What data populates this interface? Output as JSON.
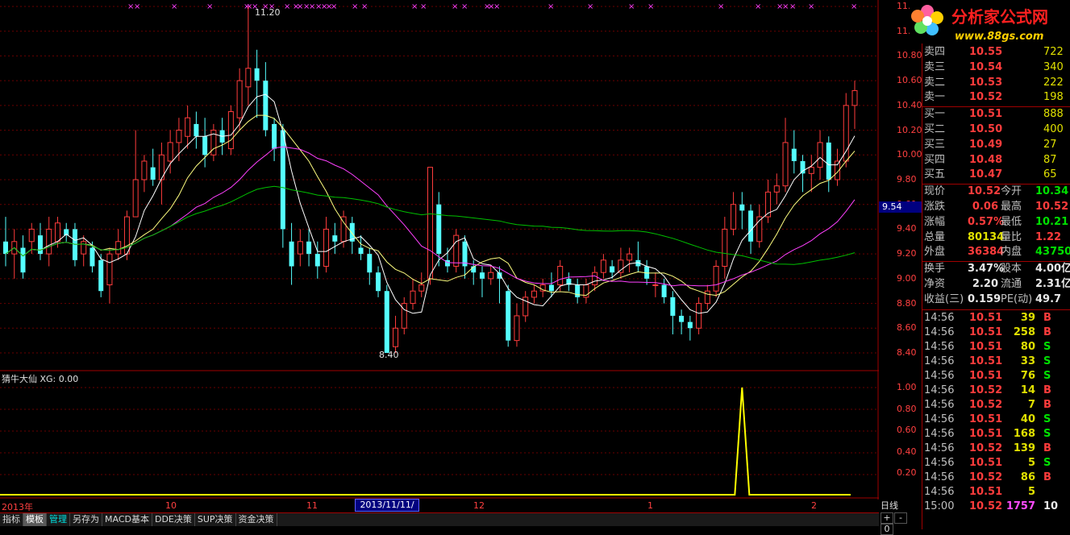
{
  "app": {
    "title_partial": "分析家公式网",
    "logo_url_text": "www.88gs.com"
  },
  "price_axis": {
    "ticks": [
      "11.20",
      "11.00",
      "10.80",
      "10.60",
      "10.40",
      "10.20",
      "10.00",
      "9.80",
      "9.60",
      "9.40",
      "9.20",
      "9.00",
      "8.80",
      "8.60",
      "8.40"
    ],
    "current_tag": "9.54"
  },
  "annotations": {
    "high_label": "11.20",
    "low_label": "8.40"
  },
  "indicator": {
    "title": "猜牛大仙 XG: 0.00",
    "ticks": [
      "1.00",
      "0.80",
      "0.60",
      "0.40",
      "0.20"
    ],
    "signal_color": "#ffff00"
  },
  "date_axis": {
    "labels": [
      {
        "text": "2013年"
      },
      {
        "text": "10"
      },
      {
        "text": "11"
      },
      {
        "text": "12"
      },
      {
        "text": "1"
      },
      {
        "text": "2"
      }
    ],
    "highlight": "2013/11/11/一",
    "period": "日线"
  },
  "zoom_buttons": [
    "+",
    "-",
    "0"
  ],
  "bottom_tabs": [
    {
      "label": "指标"
    },
    {
      "label": "模板",
      "active": true
    },
    {
      "label": "管理"
    },
    {
      "label": "另存为"
    },
    {
      "label": "MACD基本"
    },
    {
      "label": "DDE决策"
    },
    {
      "label": "SUP决策"
    },
    {
      "label": "资金决策"
    }
  ],
  "order_book": {
    "sell": [
      {
        "label": "卖四",
        "price": "10.55",
        "vol": "722"
      },
      {
        "label": "卖三",
        "price": "10.54",
        "vol": "340"
      },
      {
        "label": "卖二",
        "price": "10.53",
        "vol": "222"
      },
      {
        "label": "卖一",
        "price": "10.52",
        "vol": "198"
      }
    ],
    "buy": [
      {
        "label": "买一",
        "price": "10.51",
        "vol": "888"
      },
      {
        "label": "买二",
        "price": "10.50",
        "vol": "400"
      },
      {
        "label": "买三",
        "price": "10.49",
        "vol": "27"
      },
      {
        "label": "买四",
        "price": "10.48",
        "vol": "87"
      },
      {
        "label": "买五",
        "price": "10.47",
        "vol": "65"
      }
    ]
  },
  "stats": [
    {
      "l1": "现价",
      "v1": "10.52",
      "c1": "red",
      "l2": "今开",
      "v2": "10.34",
      "c2": "green"
    },
    {
      "l1": "涨跌",
      "v1": "0.06",
      "c1": "red",
      "l2": "最高",
      "v2": "10.52",
      "c2": "red"
    },
    {
      "l1": "涨幅",
      "v1": "0.57%",
      "c1": "red",
      "l2": "最低",
      "v2": "10.21",
      "c2": "green"
    },
    {
      "l1": "总量",
      "v1": "80134",
      "c1": "yellow",
      "l2": "量比",
      "v2": "1.22",
      "c2": "red"
    },
    {
      "l1": "外盘",
      "v1": "36384",
      "c1": "red",
      "l2": "内盘",
      "v2": "43750",
      "c2": "green"
    },
    {
      "l1": "换手",
      "v1": "3.47%",
      "c1": "white",
      "l2": "股本",
      "v2": "4.00亿",
      "c2": "white"
    },
    {
      "l1": "净资",
      "v1": "2.20",
      "c1": "white",
      "l2": "流通",
      "v2": "2.31亿",
      "c2": "white"
    },
    {
      "l1": "收益(三)",
      "v1": "0.159",
      "c1": "white",
      "l2": "PE(动)",
      "v2": "49.7",
      "c2": "white"
    }
  ],
  "trades": [
    {
      "t": "14:56",
      "p": "10.51",
      "v": "39",
      "s": "B"
    },
    {
      "t": "14:56",
      "p": "10.51",
      "v": "258",
      "s": "B"
    },
    {
      "t": "14:56",
      "p": "10.51",
      "v": "80",
      "s": "S"
    },
    {
      "t": "14:56",
      "p": "10.51",
      "v": "33",
      "s": "S"
    },
    {
      "t": "14:56",
      "p": "10.51",
      "v": "76",
      "s": "S"
    },
    {
      "t": "14:56",
      "p": "10.52",
      "v": "14",
      "s": "B"
    },
    {
      "t": "14:56",
      "p": "10.52",
      "v": "7",
      "s": "B"
    },
    {
      "t": "14:56",
      "p": "10.51",
      "v": "40",
      "s": "S"
    },
    {
      "t": "14:56",
      "p": "10.51",
      "v": "168",
      "s": "S"
    },
    {
      "t": "14:56",
      "p": "10.52",
      "v": "139",
      "s": "B"
    },
    {
      "t": "14:56",
      "p": "10.51",
      "v": "5",
      "s": "S"
    },
    {
      "t": "14:56",
      "p": "10.52",
      "v": "86",
      "s": "B"
    },
    {
      "t": "14:56",
      "p": "10.51",
      "v": "5",
      "s": ""
    },
    {
      "t": "15:00",
      "p": "10.52",
      "v": "1757",
      "s": "10"
    }
  ],
  "chart_data": {
    "type": "candlestick",
    "ylim": [
      8.3,
      11.3
    ],
    "series_colors": {
      "up": "#ff3c3c",
      "down": "#55ffff",
      "ma5": "#ffffff",
      "ma10": "#ffff80",
      "ma20": "#ff40ff",
      "ma60": "#00c000"
    },
    "candles": [
      [
        9.3,
        9.2,
        9.5,
        9.1
      ],
      [
        9.2,
        9.3,
        9.4,
        9.0
      ],
      [
        9.25,
        9.05,
        9.35,
        9.0
      ],
      [
        9.3,
        9.4,
        9.45,
        9.2
      ],
      [
        9.35,
        9.2,
        9.45,
        9.15
      ],
      [
        9.2,
        9.4,
        9.5,
        9.1
      ],
      [
        9.3,
        9.45,
        9.5,
        9.25
      ],
      [
        9.4,
        9.35,
        9.45,
        9.3
      ],
      [
        9.4,
        9.15,
        9.45,
        9.1
      ],
      [
        9.2,
        9.3,
        9.35,
        9.1
      ],
      [
        9.25,
        9.1,
        9.3,
        9.05
      ],
      [
        9.15,
        8.9,
        9.2,
        8.85
      ],
      [
        8.95,
        9.2,
        9.25,
        8.8
      ],
      [
        9.2,
        9.3,
        9.4,
        9.15
      ],
      [
        9.2,
        9.5,
        9.55,
        9.15
      ],
      [
        9.5,
        9.8,
        10.2,
        9.5
      ],
      [
        9.8,
        9.95,
        10.0,
        9.7
      ],
      [
        9.9,
        9.8,
        10.05,
        9.75
      ],
      [
        9.8,
        10.0,
        10.1,
        9.6
      ],
      [
        9.95,
        10.1,
        10.2,
        9.85
      ],
      [
        10.1,
        10.2,
        10.3,
        9.95
      ],
      [
        10.15,
        10.3,
        10.4,
        10.05
      ],
      [
        10.25,
        10.15,
        10.35,
        10.05
      ],
      [
        10.15,
        10.0,
        10.3,
        9.9
      ],
      [
        10.0,
        10.2,
        10.25,
        9.95
      ],
      [
        10.2,
        10.1,
        10.3,
        10.0
      ],
      [
        10.05,
        10.35,
        10.4,
        10.0
      ],
      [
        10.3,
        10.6,
        10.7,
        10.2
      ],
      [
        10.55,
        10.7,
        11.2,
        10.4
      ],
      [
        10.7,
        10.6,
        10.85,
        10.3
      ],
      [
        10.6,
        10.2,
        10.75,
        10.15
      ],
      [
        10.25,
        10.05,
        10.3,
        9.95
      ],
      [
        10.2,
        9.4,
        10.25,
        9.25
      ],
      [
        9.3,
        9.1,
        9.45,
        8.95
      ],
      [
        9.2,
        9.3,
        9.4,
        9.1
      ],
      [
        9.3,
        9.2,
        9.4,
        9.1
      ],
      [
        9.2,
        9.1,
        9.3,
        9.0
      ],
      [
        9.1,
        9.4,
        9.5,
        9.05
      ],
      [
        9.35,
        9.3,
        9.45,
        9.2
      ],
      [
        9.3,
        9.5,
        9.55,
        9.25
      ],
      [
        9.45,
        9.3,
        9.5,
        9.2
      ],
      [
        9.25,
        9.2,
        9.35,
        9.15
      ],
      [
        9.2,
        9.05,
        9.25,
        8.95
      ],
      [
        9.05,
        8.9,
        9.1,
        8.85
      ],
      [
        8.9,
        8.4,
        8.95,
        8.4
      ],
      [
        8.45,
        8.6,
        8.7,
        8.4
      ],
      [
        8.6,
        8.8,
        8.85,
        8.55
      ],
      [
        8.8,
        8.9,
        9.0,
        8.75
      ],
      [
        8.9,
        8.95,
        9.05,
        8.85
      ],
      [
        9.0,
        9.9,
        9.9,
        8.95
      ],
      [
        9.6,
        9.2,
        9.7,
        9.1
      ],
      [
        9.15,
        9.1,
        9.25,
        9.05
      ],
      [
        9.1,
        9.35,
        9.4,
        9.05
      ],
      [
        9.3,
        9.1,
        9.35,
        9.0
      ],
      [
        9.1,
        9.05,
        9.15,
        8.95
      ],
      [
        9.05,
        9.0,
        9.1,
        8.85
      ],
      [
        9.0,
        9.05,
        9.1,
        8.95
      ],
      [
        9.05,
        9.0,
        9.1,
        8.8
      ],
      [
        8.9,
        8.5,
        8.95,
        8.45
      ],
      [
        8.5,
        8.7,
        8.8,
        8.45
      ],
      [
        8.7,
        8.85,
        8.9,
        8.65
      ],
      [
        8.85,
        8.9,
        8.95,
        8.8
      ],
      [
        8.9,
        8.95,
        9.0,
        8.85
      ],
      [
        8.95,
        8.9,
        9.05,
        8.85
      ],
      [
        8.95,
        9.1,
        9.15,
        8.9
      ],
      [
        9.0,
        8.95,
        9.05,
        8.9
      ],
      [
        8.95,
        8.85,
        9.0,
        8.8
      ],
      [
        8.85,
        8.95,
        9.0,
        8.8
      ],
      [
        8.95,
        9.05,
        9.1,
        8.9
      ],
      [
        9.05,
        9.15,
        9.2,
        9.0
      ],
      [
        9.1,
        9.05,
        9.15,
        9.0
      ],
      [
        9.05,
        9.15,
        9.25,
        9.0
      ],
      [
        9.15,
        9.2,
        9.25,
        9.05
      ],
      [
        9.15,
        9.1,
        9.3,
        9.05
      ],
      [
        9.1,
        9.0,
        9.15,
        8.95
      ],
      [
        8.95,
        8.95,
        9.05,
        8.85
      ],
      [
        8.95,
        8.85,
        9.0,
        8.8
      ],
      [
        8.85,
        8.7,
        8.9,
        8.55
      ],
      [
        8.7,
        8.65,
        8.75,
        8.55
      ],
      [
        8.65,
        8.6,
        8.7,
        8.5
      ],
      [
        8.6,
        8.8,
        8.85,
        8.55
      ],
      [
        8.8,
        8.9,
        8.95,
        8.75
      ],
      [
        8.9,
        9.1,
        9.15,
        8.85
      ],
      [
        9.1,
        9.4,
        9.5,
        9.0
      ],
      [
        9.4,
        9.6,
        9.7,
        9.35
      ],
      [
        9.6,
        9.55,
        9.7,
        9.4
      ],
      [
        9.55,
        9.3,
        9.6,
        9.2
      ],
      [
        9.3,
        9.5,
        9.6,
        9.25
      ],
      [
        9.5,
        9.7,
        9.8,
        9.45
      ],
      [
        9.7,
        9.75,
        9.85,
        9.6
      ],
      [
        9.75,
        10.1,
        10.3,
        9.7
      ],
      [
        10.05,
        9.95,
        10.2,
        9.85
      ],
      [
        9.95,
        9.85,
        10.0,
        9.7
      ],
      [
        9.85,
        9.9,
        10.0,
        9.7
      ],
      [
        9.9,
        10.1,
        10.2,
        9.8
      ],
      [
        10.1,
        9.8,
        10.15,
        9.7
      ],
      [
        9.8,
        9.95,
        10.05,
        9.75
      ],
      [
        9.95,
        10.4,
        10.5,
        9.9
      ],
      [
        10.4,
        10.52,
        10.6,
        10.21
      ]
    ],
    "indicator_signal_index": 85
  }
}
